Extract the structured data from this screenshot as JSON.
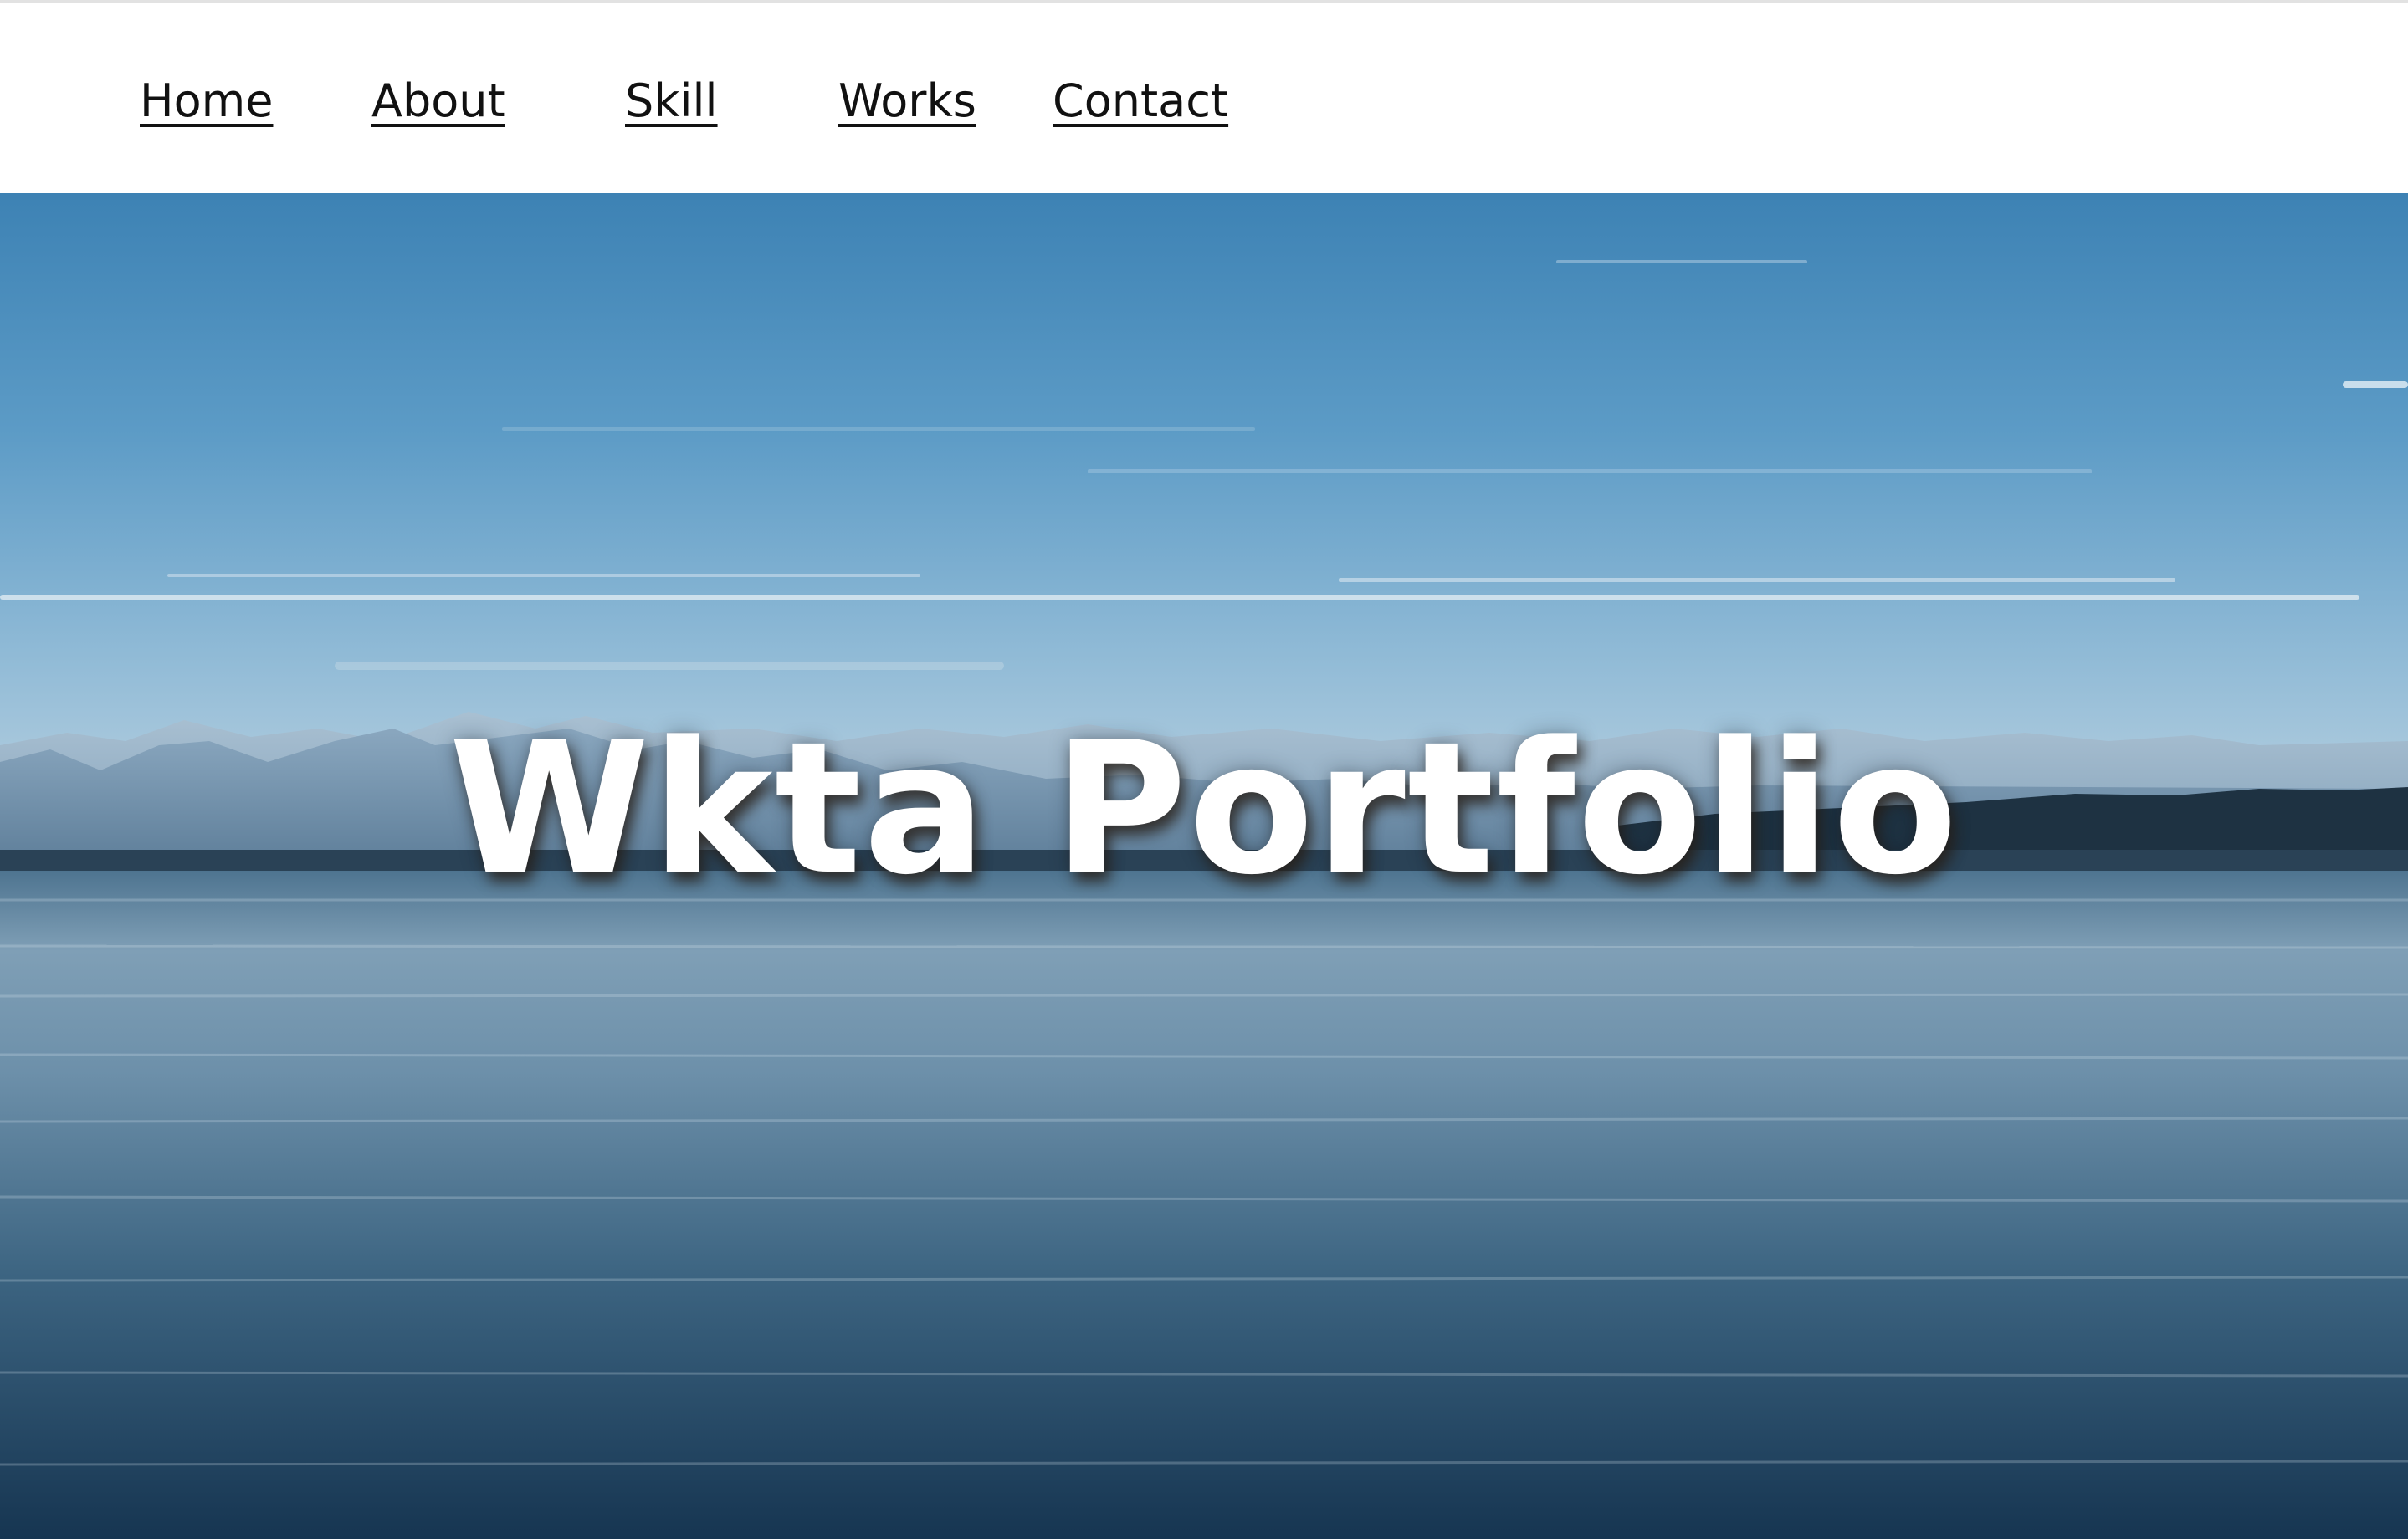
{
  "nav": {
    "items": [
      {
        "label": "Home"
      },
      {
        "label": "About"
      },
      {
        "label": "Skill"
      },
      {
        "label": "Works"
      },
      {
        "label": "Contact"
      }
    ]
  },
  "hero": {
    "title": "Wkta Portfolio",
    "image_icon": "lake-mountain-landscape",
    "colors": {
      "sky_top": "#4f8fbc",
      "sky_horizon": "#bcd3e2",
      "mountains": "#6e8fab",
      "treeline": "#1f3140",
      "water_top": "#5a7f9a",
      "water_bottom": "#17364f"
    }
  }
}
